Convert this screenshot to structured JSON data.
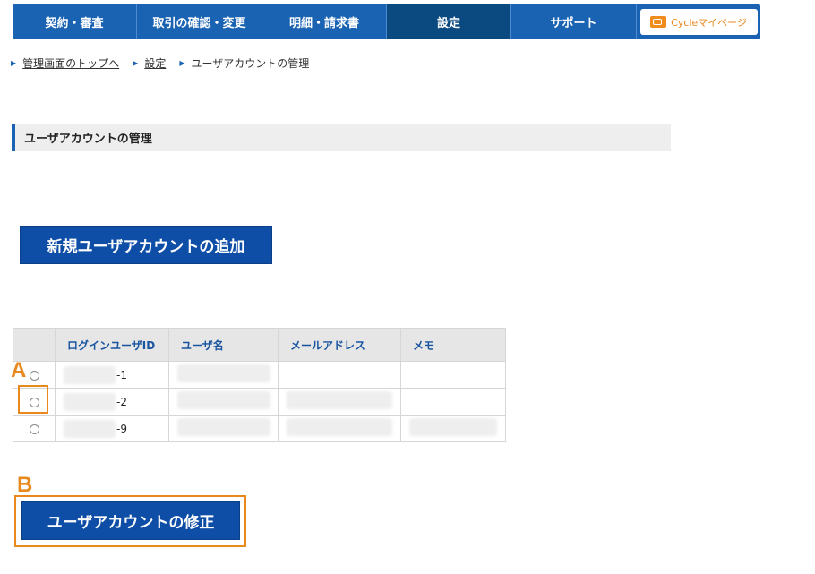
{
  "nav": {
    "items": [
      {
        "label": "契約・審査",
        "active": false
      },
      {
        "label": "取引の確認・変更",
        "active": false
      },
      {
        "label": "明細・請求書",
        "active": false
      },
      {
        "label": "設定",
        "active": true
      },
      {
        "label": "サポート",
        "active": false
      }
    ],
    "mypage_label": "Cycleマイページ"
  },
  "breadcrumb": {
    "items": [
      {
        "label": "管理画面のトップへ",
        "link": true
      },
      {
        "label": "設定",
        "link": true
      },
      {
        "label": "ユーザアカウントの管理",
        "link": false
      }
    ]
  },
  "section_title": "ユーザアカウントの管理",
  "add_button_label": "新規ユーザアカウントの追加",
  "table": {
    "headers": [
      "",
      "ログインユーザID",
      "ユーザ名",
      "メールアドレス",
      "メモ"
    ],
    "rows": [
      {
        "id_suffix": "-1"
      },
      {
        "id_suffix": "-2"
      },
      {
        "id_suffix": "-9"
      }
    ]
  },
  "annotations": {
    "a_label": "A",
    "b_label": "B",
    "color": "#e8891e"
  },
  "edit_button_label": "ユーザアカウントの修正",
  "colors": {
    "nav_bg": "#1a63b3",
    "nav_active": "#0b4a80",
    "button_bg": "#0e4ea6",
    "accent_orange": "#e8891e"
  }
}
